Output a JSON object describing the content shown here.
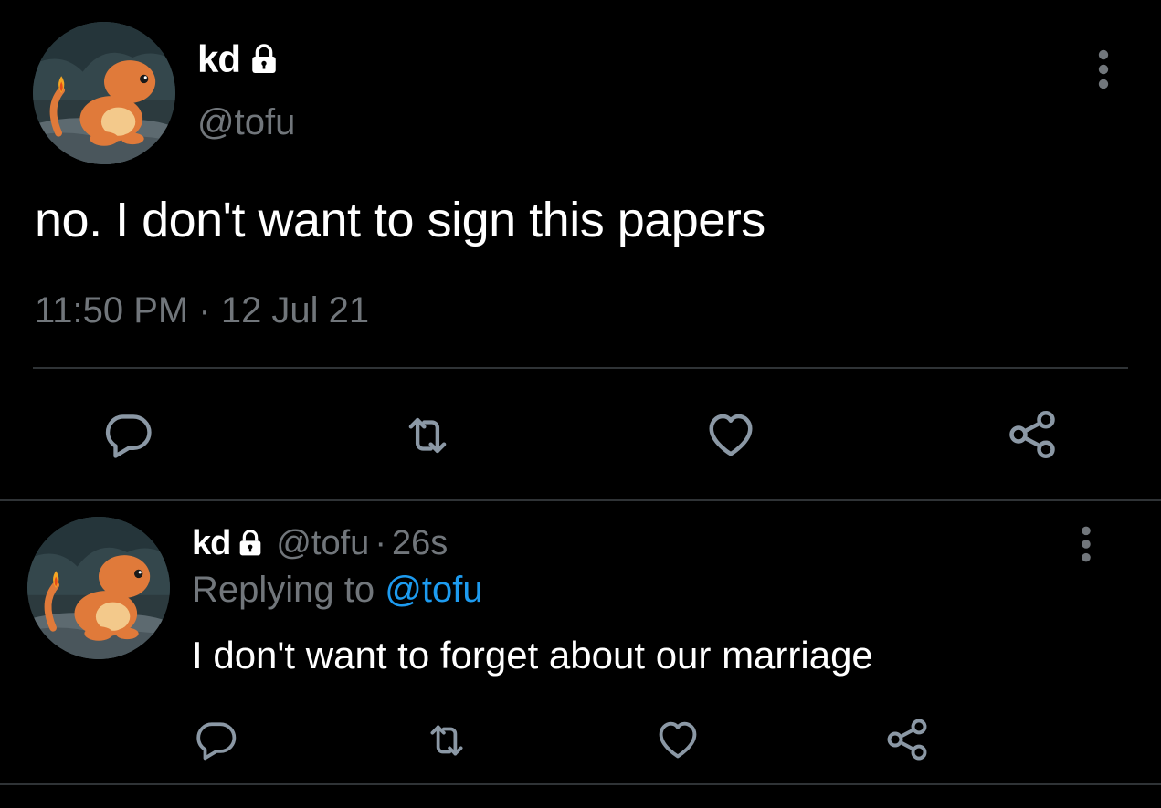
{
  "main_tweet": {
    "display_name": "kd",
    "handle": "@tofu",
    "text": "no. I don't want to sign this papers",
    "time": "11:50 PM",
    "separator": "·",
    "date": "12 Jul 21",
    "actions": [
      "reply-icon",
      "retweet-icon",
      "like-icon",
      "share-icon"
    ]
  },
  "reply_tweet": {
    "display_name": "kd",
    "handle": "@tofu",
    "separator": "·",
    "age": "26s",
    "replying_prefix": "Replying to",
    "replying_handle": "@tofu",
    "text": "I don't want to forget about our marriage",
    "actions": [
      "reply-icon",
      "retweet-icon",
      "like-icon",
      "share-icon"
    ]
  },
  "colors": {
    "background": "#000000",
    "primary_text": "#ffffff",
    "secondary_text": "#71767b",
    "link": "#1d9bf0",
    "divider": "#2f3336",
    "avatar_character": "#e07a3a"
  }
}
